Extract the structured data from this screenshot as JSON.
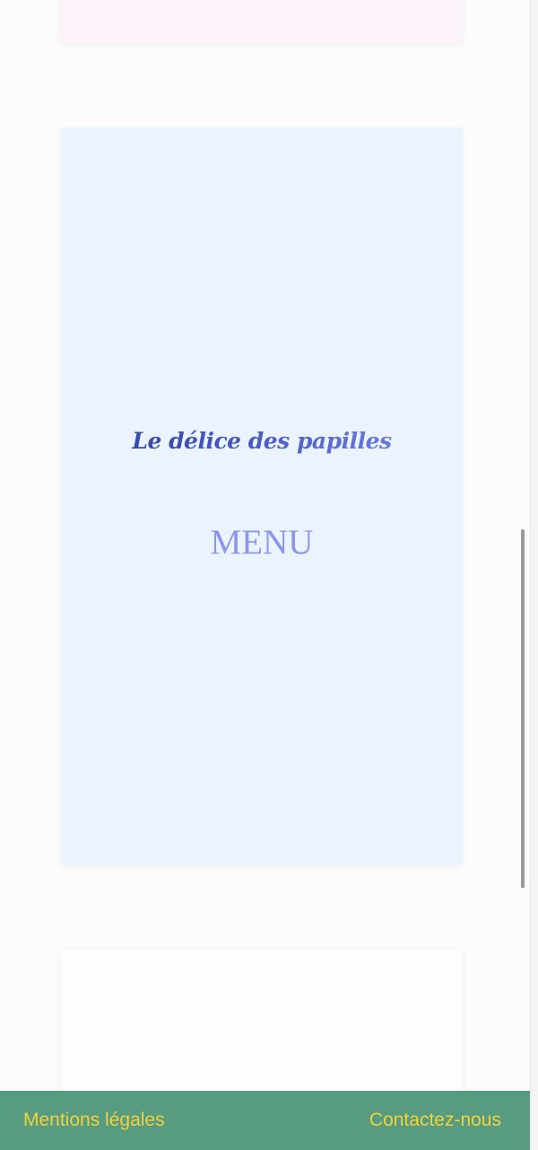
{
  "brand": {
    "name": "Le délice des papilles"
  },
  "main": {
    "menu_label": "MENU"
  },
  "footer": {
    "legal_label": "Mentions légales",
    "contact_label": "Contactez-nous"
  },
  "colors": {
    "footer_bg": "#579b81",
    "footer_link": "#f0d23c",
    "menu_text": "#8c95ec",
    "card_main_bg": "#ebf4fe",
    "card_top_bg": "#fdf3fb"
  }
}
